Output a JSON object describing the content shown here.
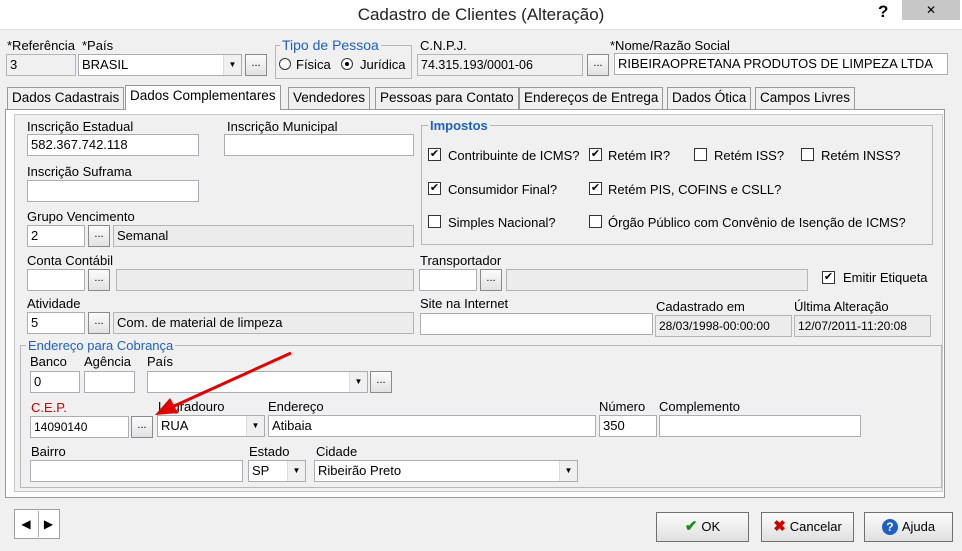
{
  "window": {
    "title": "Cadastro de Clientes (Alteração)",
    "help_icon": "?",
    "close_icon": "✕"
  },
  "header": {
    "referencia_label": "*Referência",
    "referencia_value": "3",
    "pais_label": "*País",
    "pais_value": "BRASIL",
    "tipo_pessoa_legend": "Tipo de Pessoa",
    "fisica_label": "Física",
    "juridica_label": "Jurídica",
    "cnpj_label": "C.N.P.J.",
    "cnpj_value": "74.315.193/0001-06",
    "nome_label": "*Nome/Razão Social",
    "nome_value": "RIBEIRAOPRETANA PRODUTOS DE LIMPEZA LTDA"
  },
  "tabs": [
    {
      "label": "Dados Cadastrais"
    },
    {
      "label": "Dados Complementares"
    },
    {
      "label": "Vendedores"
    },
    {
      "label": "Pessoas para Contato"
    },
    {
      "label": "Endereços de Entrega"
    },
    {
      "label": "Dados Ótica"
    },
    {
      "label": "Campos Livres"
    }
  ],
  "form": {
    "ie_label": "Inscrição Estadual",
    "ie_value": "582.367.742.118",
    "im_label": "Inscrição Municipal",
    "im_value": "",
    "suframa_label": "Inscrição Suframa",
    "suframa_value": "",
    "grupo_label": "Grupo Vencimento",
    "grupo_code": "2",
    "grupo_desc": "Semanal",
    "conta_label": "Conta Contábil",
    "conta_code": "",
    "conta_desc": "",
    "transp_label": "Transportador",
    "transp_code": "",
    "transp_desc": "",
    "emitir_label": "Emitir Etiqueta",
    "atividade_label": "Atividade",
    "atividade_code": "5",
    "atividade_desc": "Com. de material de limpeza",
    "site_label": "Site na Internet",
    "site_value": "",
    "cadastrado_label": "Cadastrado em",
    "cadastrado_value": "28/03/1998-00:00:00",
    "ultima_label": "Última Alteração",
    "ultima_value": "12/07/2011-11:20:08"
  },
  "impostos": {
    "legend": "Impostos",
    "items": [
      {
        "label": "Contribuinte de ICMS?",
        "checked": true
      },
      {
        "label": "Retém IR?",
        "checked": true
      },
      {
        "label": "Retém ISS?",
        "checked": false
      },
      {
        "label": "Retém INSS?",
        "checked": false
      },
      {
        "label": "Consumidor Final?",
        "checked": true
      },
      {
        "label": "Retém PIS, COFINS e CSLL?",
        "checked": true
      },
      {
        "label": "Simples Nacional?",
        "checked": false
      },
      {
        "label": "Órgão Público com Convênio de Isenção de ICMS?",
        "checked": false
      }
    ]
  },
  "cobranca": {
    "legend": "Endereço para Cobrança",
    "banco_label": "Banco",
    "banco_value": "0",
    "agencia_label": "Agência",
    "agencia_value": "",
    "pais_label": "País",
    "pais_value": "",
    "cep_label": "C.E.P.",
    "cep_value": "14090140",
    "logradouro_label": "Logradouro",
    "logradouro_value": "RUA",
    "endereco_label": "Endereço",
    "endereco_value": "Atibaia",
    "numero_label": "Número",
    "numero_value": "350",
    "complemento_label": "Complemento",
    "complemento_value": "",
    "bairro_label": "Bairro",
    "bairro_value": "",
    "estado_label": "Estado",
    "estado_value": "SP",
    "cidade_label": "Cidade",
    "cidade_value": "Ribeirão Preto"
  },
  "footer": {
    "ok_label": "OK",
    "cancelar_label": "Cancelar",
    "ajuda_label": "Ajuda"
  },
  "colors": {
    "accent": "#1e5fc4",
    "required": "#cc0000",
    "arrow": "#e00000"
  }
}
